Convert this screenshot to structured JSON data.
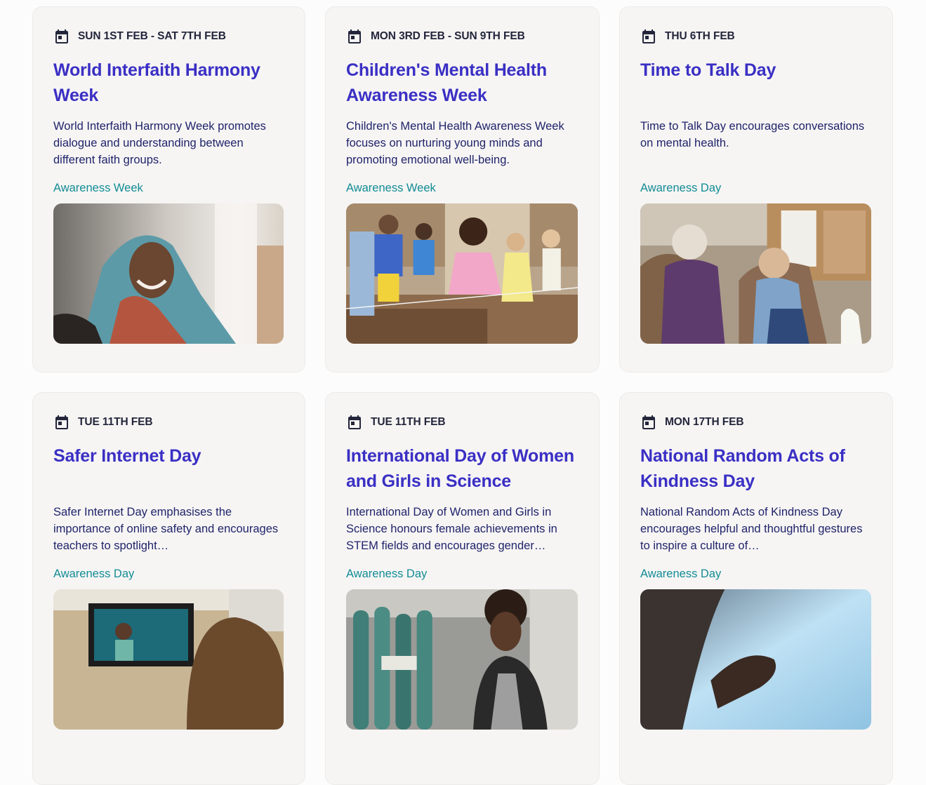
{
  "events": [
    {
      "date": "SUN 1ST FEB - SAT 7TH FEB",
      "title": "World Interfaith Harmony Week",
      "description": "World Interfaith Harmony Week promotes dialogue and understanding between different faith groups.",
      "category": "Awareness Week",
      "image": "smiling-woman-headscarf-photo"
    },
    {
      "date": "MON 3RD FEB - SUN 9TH FEB",
      "title": "Children's Mental Health Awareness Week",
      "description": "Children's Mental Health Awareness Week focuses on nurturing young minds and promoting emotional well-being.",
      "category": "Awareness Week",
      "image": "children-playing-elastics-photo"
    },
    {
      "date": "THU 6TH FEB",
      "title": "Time to Talk Day",
      "description": "Time to Talk Day encourages conversations on mental health.",
      "category": "Awareness Day",
      "image": "elderly-woman-and-girl-talking-photo"
    },
    {
      "date": "TUE 11TH FEB",
      "title": "Safer Internet Day",
      "description": "Safer Internet Day emphasises the importance of online safety and encourages teachers to spotlight…",
      "category": "Awareness Day",
      "image": "pupil-watching-screen-photo"
    },
    {
      "date": "TUE 11TH FEB",
      "title": "International Day of Women and Girls in Science",
      "description": "International Day of Women and Girls in Science honours female achievements in STEM fields and encourages gender…",
      "category": "Awareness Day",
      "image": "scientist-with-gas-cylinders-photo"
    },
    {
      "date": "MON 17TH FEB",
      "title": "National Random Acts of Kindness Day",
      "description": "National Random Acts of Kindness Day encourages helpful and thoughtful gestures to inspire a culture of…",
      "category": "Awareness Day",
      "image": "helping-hand-photo"
    }
  ],
  "colors": {
    "title": "#3a2fc4",
    "category": "#138c95",
    "date": "#23263b",
    "card_bg": "#f6f5f4"
  },
  "icons": {
    "date": "calendar-icon"
  }
}
